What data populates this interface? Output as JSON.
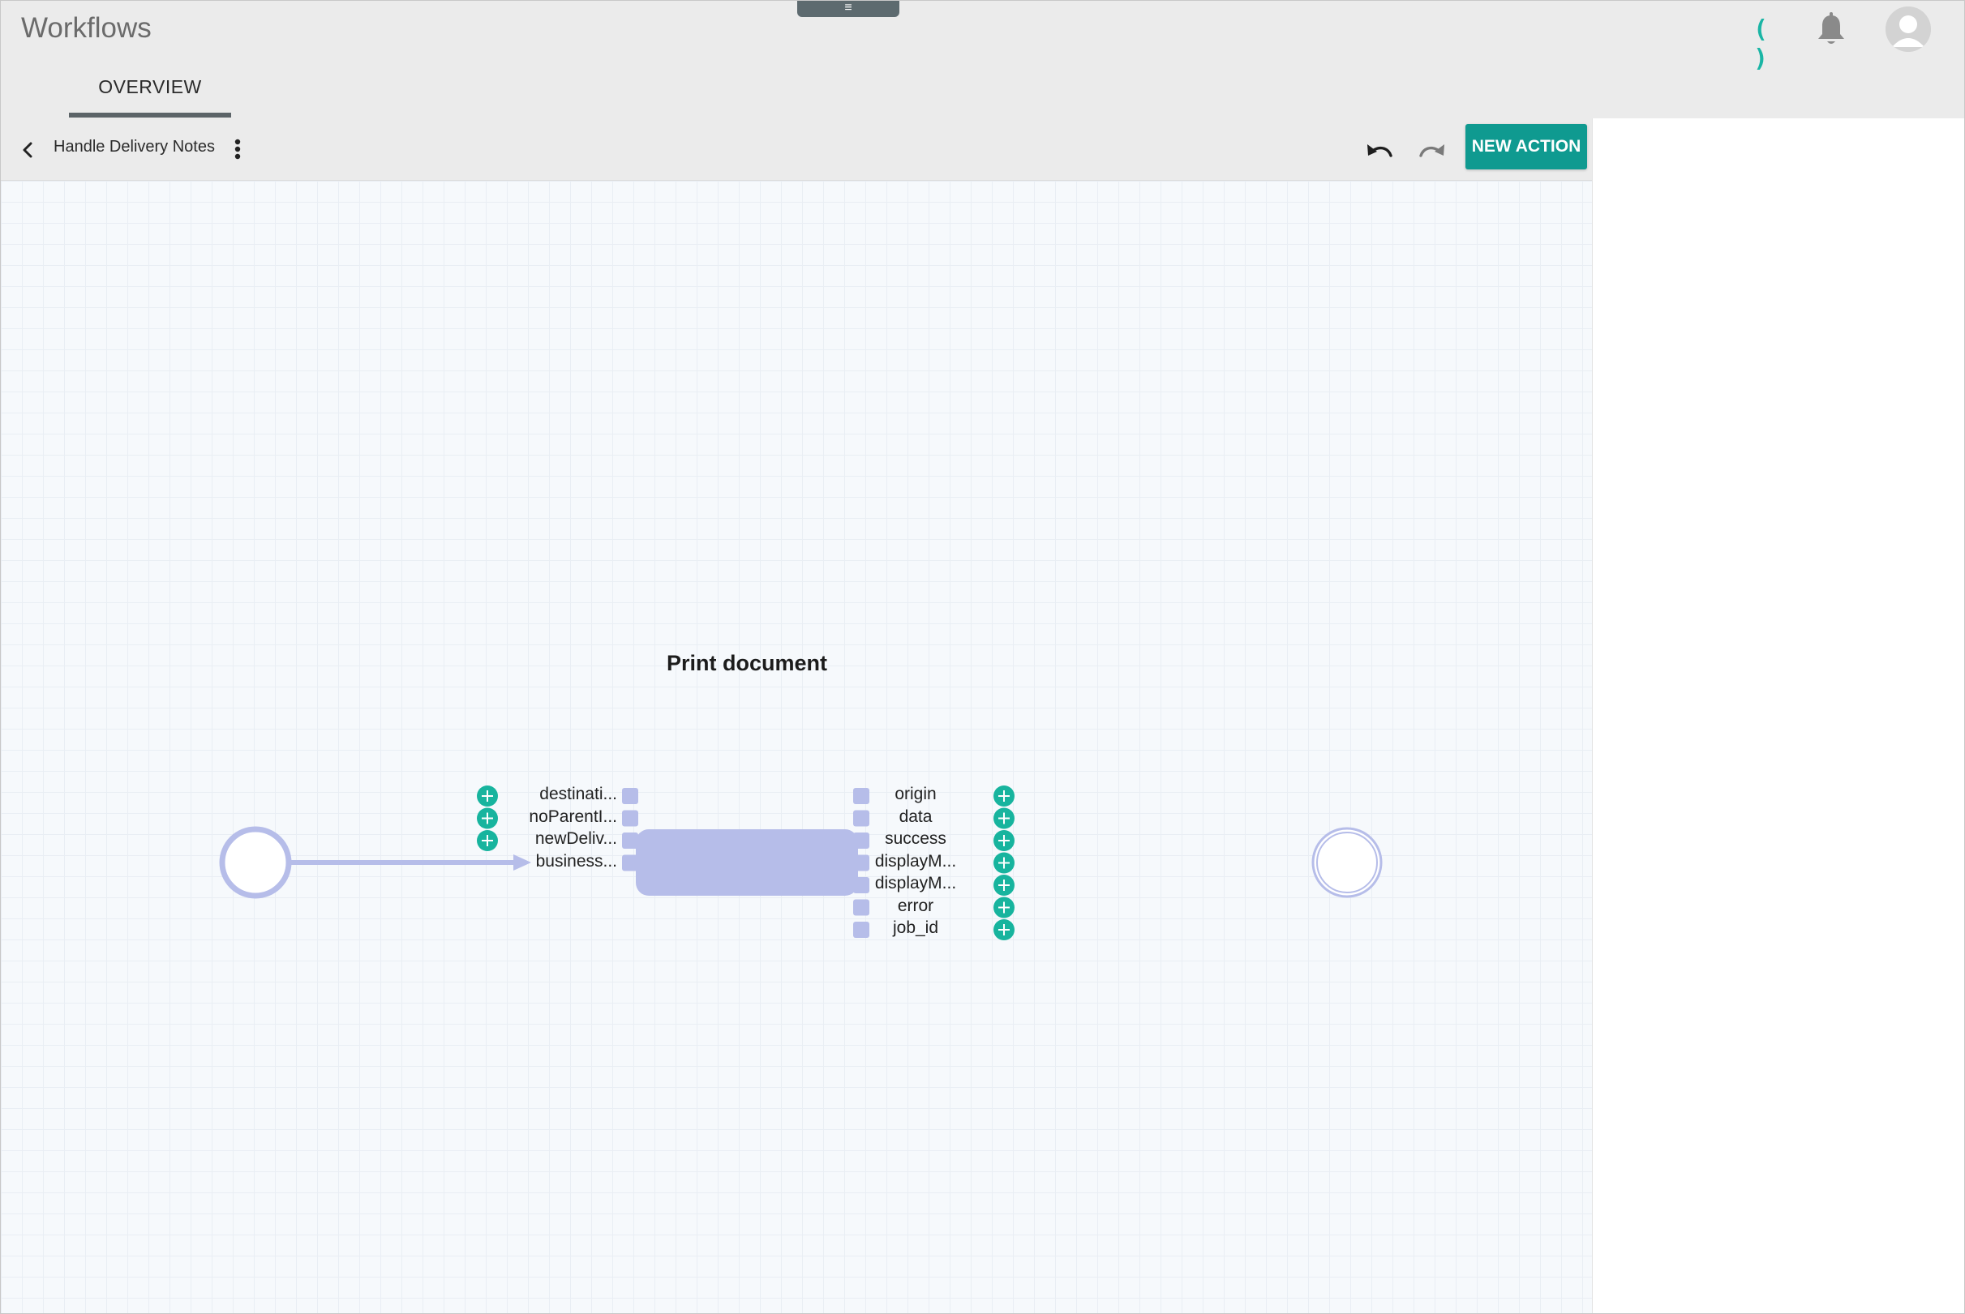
{
  "app": {
    "title": "Workflows",
    "drawer_handle": "≡"
  },
  "header": {
    "loader_glyph": "( )",
    "icons": [
      "loader-icon",
      "bell-icon",
      "user-avatar-icon"
    ]
  },
  "tabs": [
    {
      "label": "OVERVIEW",
      "active": true
    }
  ],
  "toolbar": {
    "workflow_name": "Handle Delivery Notes",
    "new_action_label": "NEW ACTION",
    "icons": [
      "chevron-left-icon",
      "more-vert-icon",
      "undo-icon",
      "redo-icon"
    ]
  },
  "workflow": {
    "node": {
      "title": "Print document",
      "inputs": [
        "destinati...",
        "noParentI...",
        "newDeliv...",
        "business..."
      ],
      "outputs": [
        "origin",
        "data",
        "success",
        "displayM...",
        "displayM...",
        "error",
        "job_id"
      ]
    }
  },
  "colors": {
    "accent": "#0f9a90",
    "plus": "#17b49e",
    "node": "#b6bde9",
    "header": "#ebebeb",
    "canvas": "#f6f9fc"
  }
}
